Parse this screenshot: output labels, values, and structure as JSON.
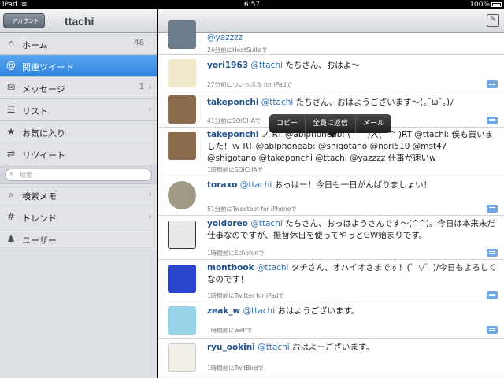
{
  "status_bar": {
    "carrier": "iPad",
    "time": "6:57",
    "battery": "100%"
  },
  "sidebar": {
    "back_button": "アカウント",
    "account": "ttachi",
    "items": [
      {
        "label": "ホーム",
        "count": "48",
        "icon": "home-icon"
      },
      {
        "label": "関連ツイート",
        "count": "",
        "icon": "at-icon"
      },
      {
        "label": "メッセージ",
        "count": "1",
        "icon": "envelope-icon"
      },
      {
        "label": "リスト",
        "count": "",
        "icon": "list-icon"
      },
      {
        "label": "お気に入り",
        "count": "",
        "icon": "star-icon"
      },
      {
        "label": "リツイート",
        "count": "",
        "icon": "retweet-icon"
      }
    ],
    "search_placeholder": "検索",
    "items2": [
      {
        "label": "検索メモ",
        "icon": "search-memo-icon"
      },
      {
        "label": "トレンド",
        "icon": "hash-icon"
      },
      {
        "label": "ユーザー",
        "icon": "user-icon"
      }
    ]
  },
  "popup": {
    "copy": "コピー",
    "reply_all": "全員に返信",
    "mail": "メール"
  },
  "tweets": [
    {
      "user": "",
      "text": "@yazzzz",
      "meta": "24分前にHootSuiteで"
    },
    {
      "user": "yori1963",
      "mention": "@ttachi",
      "text": " たちさん、おはよ〜",
      "meta": "27分前についっぷる for iPadで"
    },
    {
      "user": "takeponchi",
      "mention": "@ttachi",
      "text": " たちさん、おはようございます〜(｡˘ω˘｡)ﾉ",
      "meta": "41分前にSOICHAで"
    },
    {
      "user": "takeponchi",
      "mention": "",
      "text": " ノ RT @abiphoneab: ( ^^)人(^^ )RT @ttachi: 僕も買いました！ｗ RT @abiphoneab: @shigotano @nori510 @mst47 @shigotano @takeponchi @ttachi @yazzzz 仕事が速いw",
      "meta": "1時間前にSOICHAで"
    },
    {
      "user": "toraxo",
      "mention": "@ttachi",
      "text": " おっはー！今日も一日がんばりましょい！",
      "meta": "51分前にTweetbot for iPhoneで"
    },
    {
      "user": "yoidoreo",
      "mention": "@ttachi",
      "text": " たちさん、おっはようさんです〜(^^)。今日は本来未だ仕事なのですが、振替休日を使ってやっとGW始まりです。",
      "meta": "1時間前にEchofonで"
    },
    {
      "user": "montbook",
      "mention": "@ttachi",
      "text": " タチさん、オハイオさまです！(゜▽゜)/今日もよろしくなのです！",
      "meta": "1時間前にTwitter for iPadで"
    },
    {
      "user": "zeak_w",
      "mention": "@ttachi",
      "text": " おはようございます。",
      "meta": "1時間前にwebで"
    },
    {
      "user": "ryu_ookini",
      "mention": "@ttachi",
      "text": " おはよーございます。",
      "meta": "1時間前にTwitBirdで"
    }
  ]
}
